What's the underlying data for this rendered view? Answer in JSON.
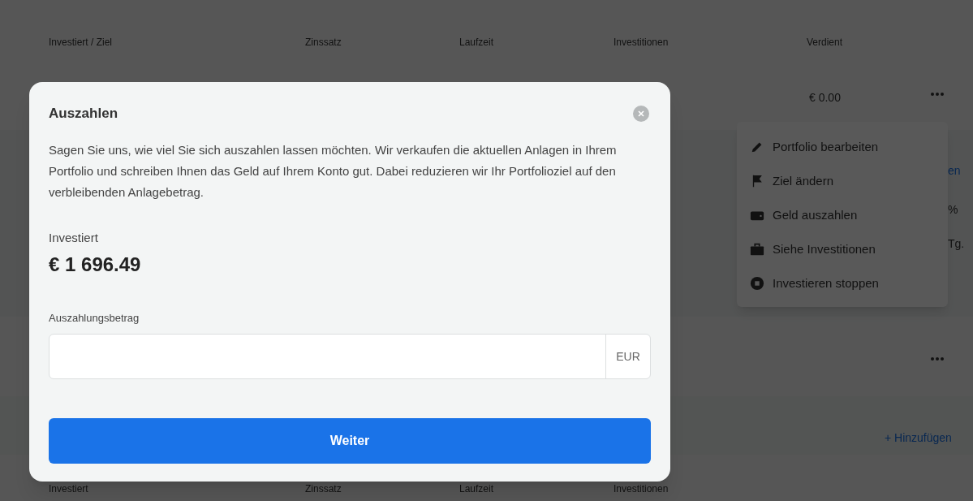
{
  "table": {
    "columns": [
      "Investiert / Ziel",
      "Zinssatz",
      "Laufzeit",
      "Investitionen",
      "Verdient"
    ],
    "rows": [
      {
        "earned": "€ 0.00"
      }
    ],
    "side_texts": [
      "en",
      "%",
      "Tg."
    ],
    "add_link": "+ Hinzufügen",
    "second_header": [
      "Investiert",
      "Zinssatz",
      "Laufzeit",
      "Investitionen"
    ]
  },
  "row_menu": {
    "items": [
      "Portfolio bearbeiten",
      "Ziel ändern",
      "Geld auszahlen",
      "Siehe Investitionen",
      "Investieren stoppen"
    ]
  },
  "dialog": {
    "title": "Auszahlen",
    "description": "Sagen Sie uns, wie viel Sie sich auszahlen lassen möchten. Wir verkaufen die aktuellen Anlagen in Ihrem Portfolio und schreiben Ihnen das Geld auf Ihrem Konto gut. Dabei reduzieren wir Ihr Portfolioziel auf den verbleibenden Anlagebetrag.",
    "invested_label": "Investiert",
    "invested_value": "€ 1 696.49",
    "amount_label": "Auszahlungsbetrag",
    "currency": "EUR",
    "button": "Weiter"
  }
}
